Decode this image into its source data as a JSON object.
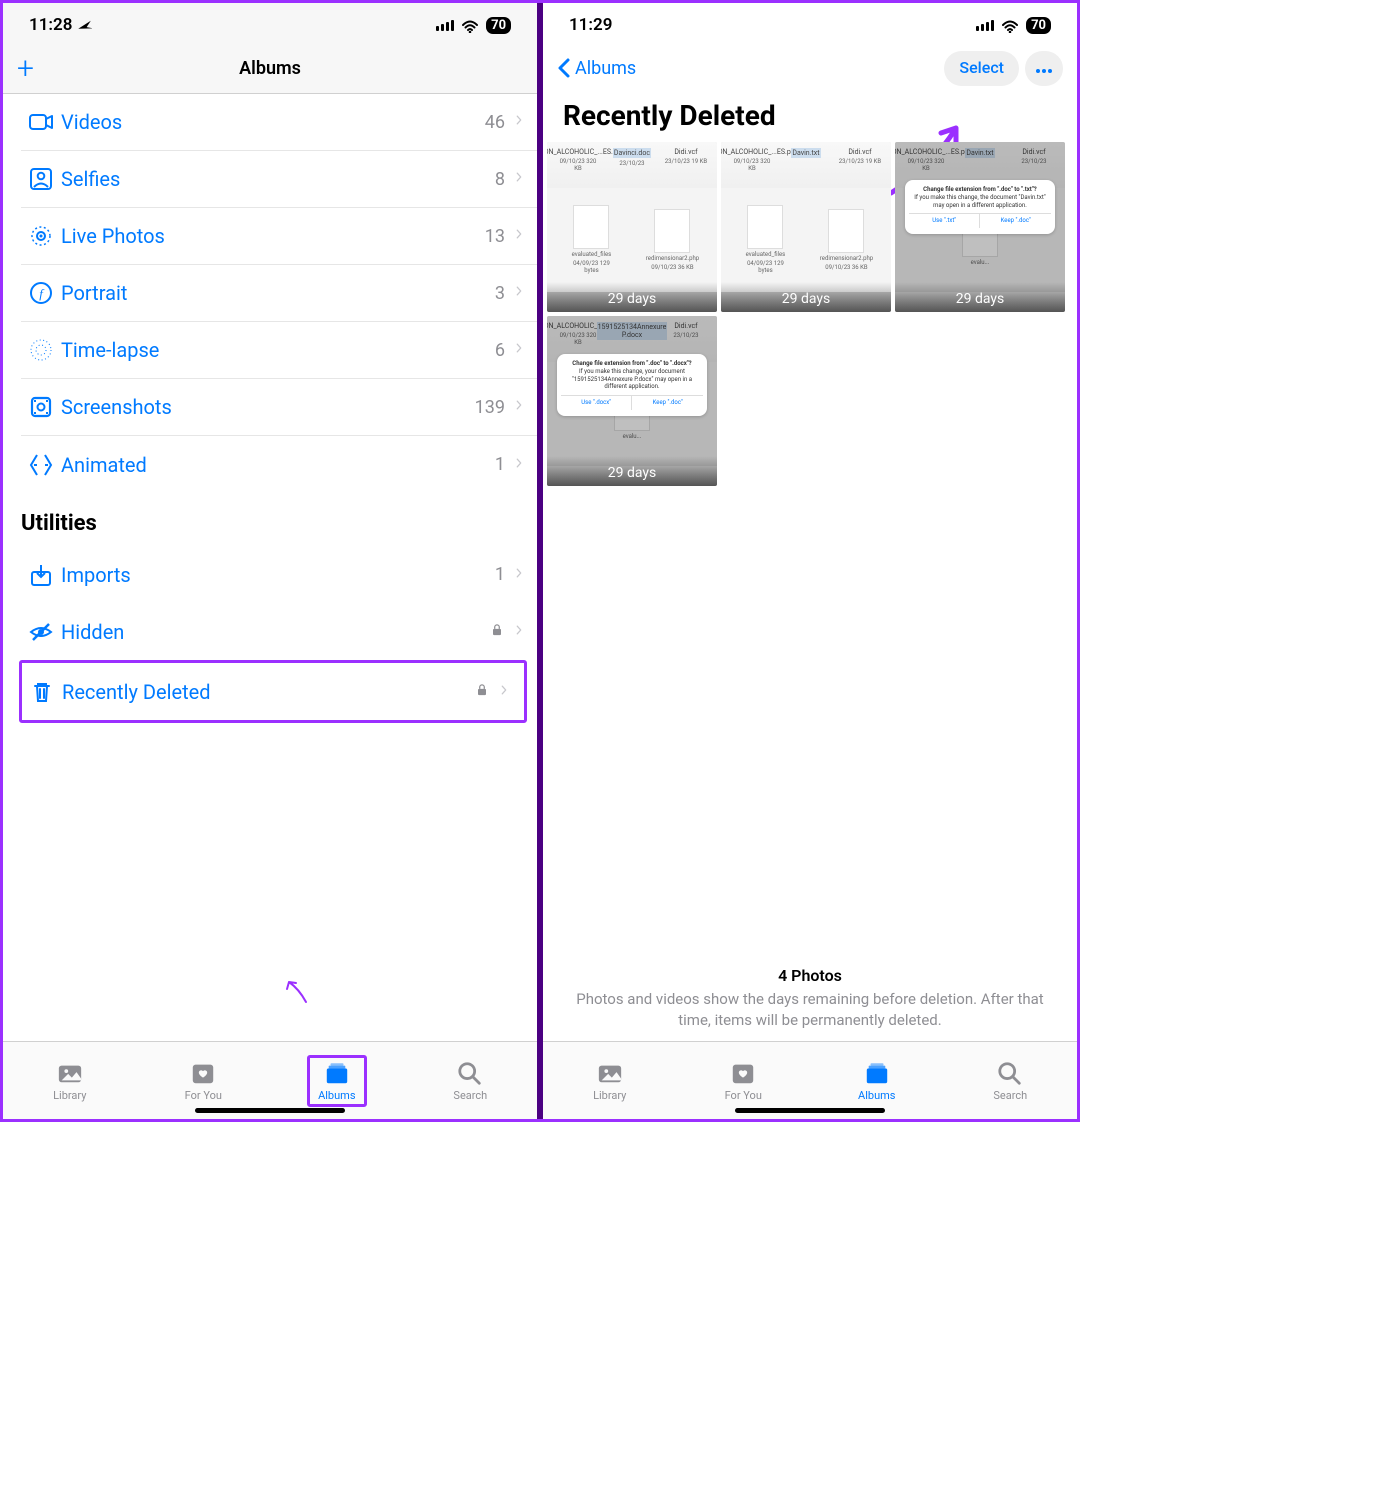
{
  "status": {
    "time_left": "11:28",
    "time_right": "11:29",
    "battery": "70"
  },
  "left": {
    "nav_title": "Albums",
    "media_items": [
      {
        "icon": "video",
        "label": "Videos",
        "count": "46"
      },
      {
        "icon": "selfies",
        "label": "Selfies",
        "count": "8"
      },
      {
        "icon": "live",
        "label": "Live Photos",
        "count": "13"
      },
      {
        "icon": "portrait",
        "label": "Portrait",
        "count": "3"
      },
      {
        "icon": "timelapse",
        "label": "Time-lapse",
        "count": "6"
      },
      {
        "icon": "screenshots",
        "label": "Screenshots",
        "count": "139"
      },
      {
        "icon": "animated",
        "label": "Animated",
        "count": "1"
      }
    ],
    "utilities_header": "Utilities",
    "utilities": [
      {
        "icon": "imports",
        "label": "Imports",
        "count": "1",
        "locked": false
      },
      {
        "icon": "hidden",
        "label": "Hidden",
        "count": "",
        "locked": true
      },
      {
        "icon": "trash",
        "label": "Recently Deleted",
        "count": "",
        "locked": true
      }
    ]
  },
  "right": {
    "back_label": "Albums",
    "select_label": "Select",
    "title": "Recently Deleted",
    "thumbs": [
      {
        "overlay": "29 days",
        "dialog": null,
        "file1": "S.NON_ALCOHOLIC_...ES.pdf",
        "sub1": "09/10/23 320 KB",
        "file2": "Davinci.doc",
        "sub2": "23/10/23",
        "file3": "Didi.vcf",
        "sub3": "23/10/23 19 KB",
        "mid": [
          {
            "n": "evaluated_files",
            "s": "04/09/23 129 bytes"
          },
          {
            "n": "redimensionar2.php",
            "s": "09/10/23 36 KB"
          }
        ]
      },
      {
        "overlay": "29 days",
        "dialog": null,
        "file1": "S.NON_ALCOHOLIC_...ES.pdf",
        "sub1": "09/10/23 320 KB",
        "file2": "Davin.txt",
        "sub2": "",
        "file3": "Didi.vcf",
        "sub3": "23/10/23 19 KB",
        "mid": [
          {
            "n": "evaluated_files",
            "s": "04/09/23 129 bytes"
          },
          {
            "n": "redimensionar2.php",
            "s": "09/10/23 36 KB"
          }
        ]
      },
      {
        "overlay": "29 days",
        "dialog": {
          "title": "Change file extension from \".doc\" to \".txt\"?",
          "body": "If you make this change, the document \"Davin.txt\" may open in a different application.",
          "btn1": "Use \".txt\"",
          "btn2": "Keep \".doc\""
        },
        "file1": "S.NON_ALCOHOLIC_...ES.pdf",
        "sub1": "09/10/23 320 KB",
        "file2": "Davin.txt",
        "sub2": "",
        "file3": "Didi.vcf",
        "sub3": "23/10/23",
        "mid": []
      },
      {
        "overlay": "29 days",
        "dialog": {
          "title": "Change file extension from \".doc\" to \".docx\"?",
          "body": "If you make this change, your document \"1591525134Annexure P.docx\" may open in a different application.",
          "btn1": "Use \".docx\"",
          "btn2": "Keep \".doc\""
        },
        "file1": "S.NON_ALCOHOLIC_...ES.pdf",
        "sub1": "09/10/23 320 KB",
        "file2": "1591525134Annexure P.docx",
        "sub2": "",
        "file3": "Didi.vcf",
        "sub3": "23/10/23",
        "mid": []
      }
    ],
    "footer_title": "4 Photos",
    "footer_body": "Photos and videos show the days remaining before deletion. After that time, items will be permanently deleted."
  },
  "tabs": [
    {
      "label": "Library",
      "icon": "library"
    },
    {
      "label": "For You",
      "icon": "foryou"
    },
    {
      "label": "Albums",
      "icon": "albums"
    },
    {
      "label": "Search",
      "icon": "search"
    }
  ]
}
